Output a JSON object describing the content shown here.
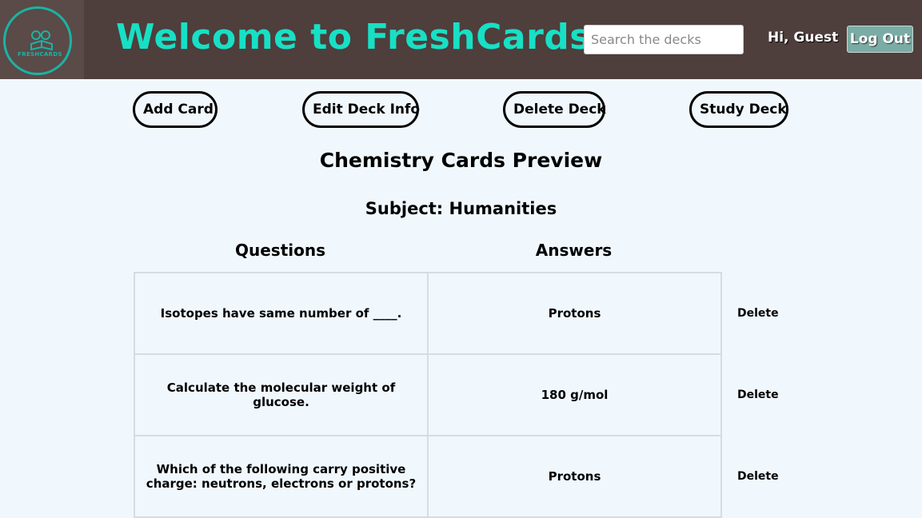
{
  "header": {
    "logo_text": "FRESHCARDS",
    "title": "Welcome to FreshCards",
    "search_placeholder": "Search the decks",
    "greeting": "Hi, Guest",
    "logout_label": "Log Out"
  },
  "actions": {
    "add_card": "Add Card",
    "edit_deck": "Edit Deck Info",
    "delete_deck": "Delete Deck",
    "study_deck": "Study Deck"
  },
  "deck": {
    "title": "Chemistry Cards Preview",
    "subject": "Subject: Humanities",
    "questions_header": "Questions",
    "answers_header": "Answers",
    "cards": [
      {
        "question": "Isotopes have same number of ____.",
        "answer": "Protons",
        "delete": "Delete"
      },
      {
        "question": "Calculate the molecular weight of glucose.",
        "answer": "180 g/mol",
        "delete": "Delete"
      },
      {
        "question": "Which of the following carry positive charge: neutrons, electrons or protons?",
        "answer": "Protons",
        "delete": "Delete"
      }
    ]
  },
  "colors": {
    "header_bg": "#4e3e3c",
    "accent": "#17e0c5",
    "page_bg": "#f1f8fd",
    "logout_bg": "#7aaca5"
  }
}
